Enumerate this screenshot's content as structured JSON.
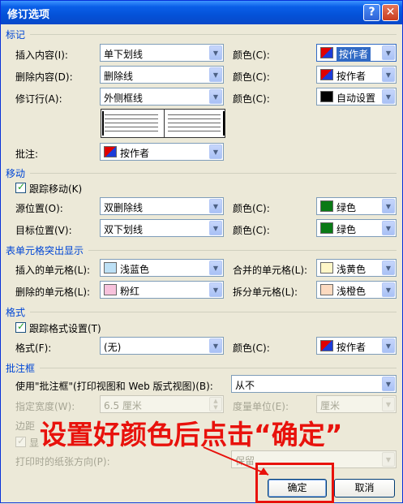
{
  "window": {
    "title": "修订选项"
  },
  "titlebar": {
    "help_glyph": "?",
    "close_glyph": "✕"
  },
  "colors": {
    "section_blue": "#0046D5",
    "highlight_red": "#E8120C"
  },
  "markup": {
    "section_label": "标记",
    "insertions": {
      "label": "插入内容(I):",
      "value": "单下划线",
      "color_label": "颜色(C):",
      "color_value": "按作者"
    },
    "deletions": {
      "label": "删除内容(D):",
      "value": "删除线",
      "color_label": "颜色(C):",
      "color_value": "按作者"
    },
    "changed_lines": {
      "label": "修订行(A):",
      "value": "外侧框线",
      "color_label": "颜色(C):",
      "color_value": "自动设置"
    },
    "comments": {
      "label": "批注:",
      "value": "按作者"
    }
  },
  "moves": {
    "section_label": "移动",
    "track_label": "跟踪移动(K)",
    "track_checked": true,
    "from": {
      "label": "源位置(O):",
      "value": "双删除线",
      "color_label": "颜色(C):",
      "color_value": "绿色"
    },
    "to": {
      "label": "目标位置(V):",
      "value": "双下划线",
      "color_label": "颜色(C):",
      "color_value": "绿色"
    }
  },
  "table": {
    "section_label": "表单元格突出显示",
    "inserted": {
      "label": "插入的单元格(L):",
      "value": "浅蓝色"
    },
    "merged": {
      "label": "合并的单元格(L):",
      "value": "浅黄色"
    },
    "deleted": {
      "label": "删除的单元格(L):",
      "value": "粉红"
    },
    "split": {
      "label": "拆分单元格(L):",
      "value": "浅橙色"
    }
  },
  "formatting": {
    "section_label": "格式",
    "track_label": "跟踪格式设置(T)",
    "track_checked": true,
    "format": {
      "label": "格式(F):",
      "value": "(无)",
      "color_label": "颜色(C):",
      "color_value": "按作者"
    }
  },
  "balloons": {
    "section_label": "批注框",
    "use_label": "使用\"批注框\"(打印视图和 Web 版式视图)(B):",
    "use_value": "从不",
    "width_label": "指定宽度(W):",
    "width_value": "6.5 厘米",
    "unit_label": "度量单位(E):",
    "unit_value": "厘米",
    "margin_label": "边距",
    "show_lines_label": "显",
    "orientation_label": "打印时的纸张方向(P):",
    "orientation_value": "保留"
  },
  "buttons": {
    "ok": "确定",
    "cancel": "取消"
  },
  "annotation": {
    "text": "设置好颜色后点击“确定”"
  }
}
